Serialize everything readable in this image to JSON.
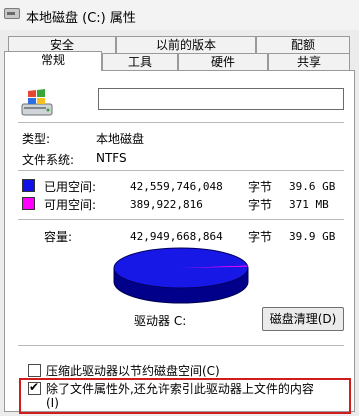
{
  "window": {
    "title": "本地磁盘 (C:) 属性"
  },
  "tabs": {
    "back_row": [
      "安全",
      "以前的版本",
      "配额"
    ],
    "front_row": [
      "常规",
      "工具",
      "硬件",
      "共享"
    ],
    "active": "常规"
  },
  "general": {
    "drive_name_value": "",
    "type_label": "类型:",
    "type_value": "本地磁盘",
    "fs_label": "文件系统:",
    "fs_value": "NTFS"
  },
  "space": {
    "used": {
      "label": "已用空间:",
      "bytes": "42,559,746,048",
      "unit": "字节",
      "human": "39.6 GB",
      "color": "#1010e8"
    },
    "free": {
      "label": "可用空间:",
      "bytes": "389,922,816",
      "unit": "字节",
      "human": "371 MB",
      "color": "#ff00ff"
    },
    "capacity": {
      "label": "容量:",
      "bytes": "42,949,668,864",
      "unit": "字节",
      "human": "39.9 GB"
    },
    "used_fraction": 0.991
  },
  "drive": {
    "label": "驱动器 C:",
    "cleanup_button": "磁盘清理(D)"
  },
  "options": {
    "compress": {
      "label": "压缩此驱动器以节约磁盘空间(C)",
      "checked": false
    },
    "index": {
      "label_line1": "除了文件属性外,还允许索引此驱动器上文件的内容",
      "label_line2": "(I)",
      "checked": true
    }
  }
}
